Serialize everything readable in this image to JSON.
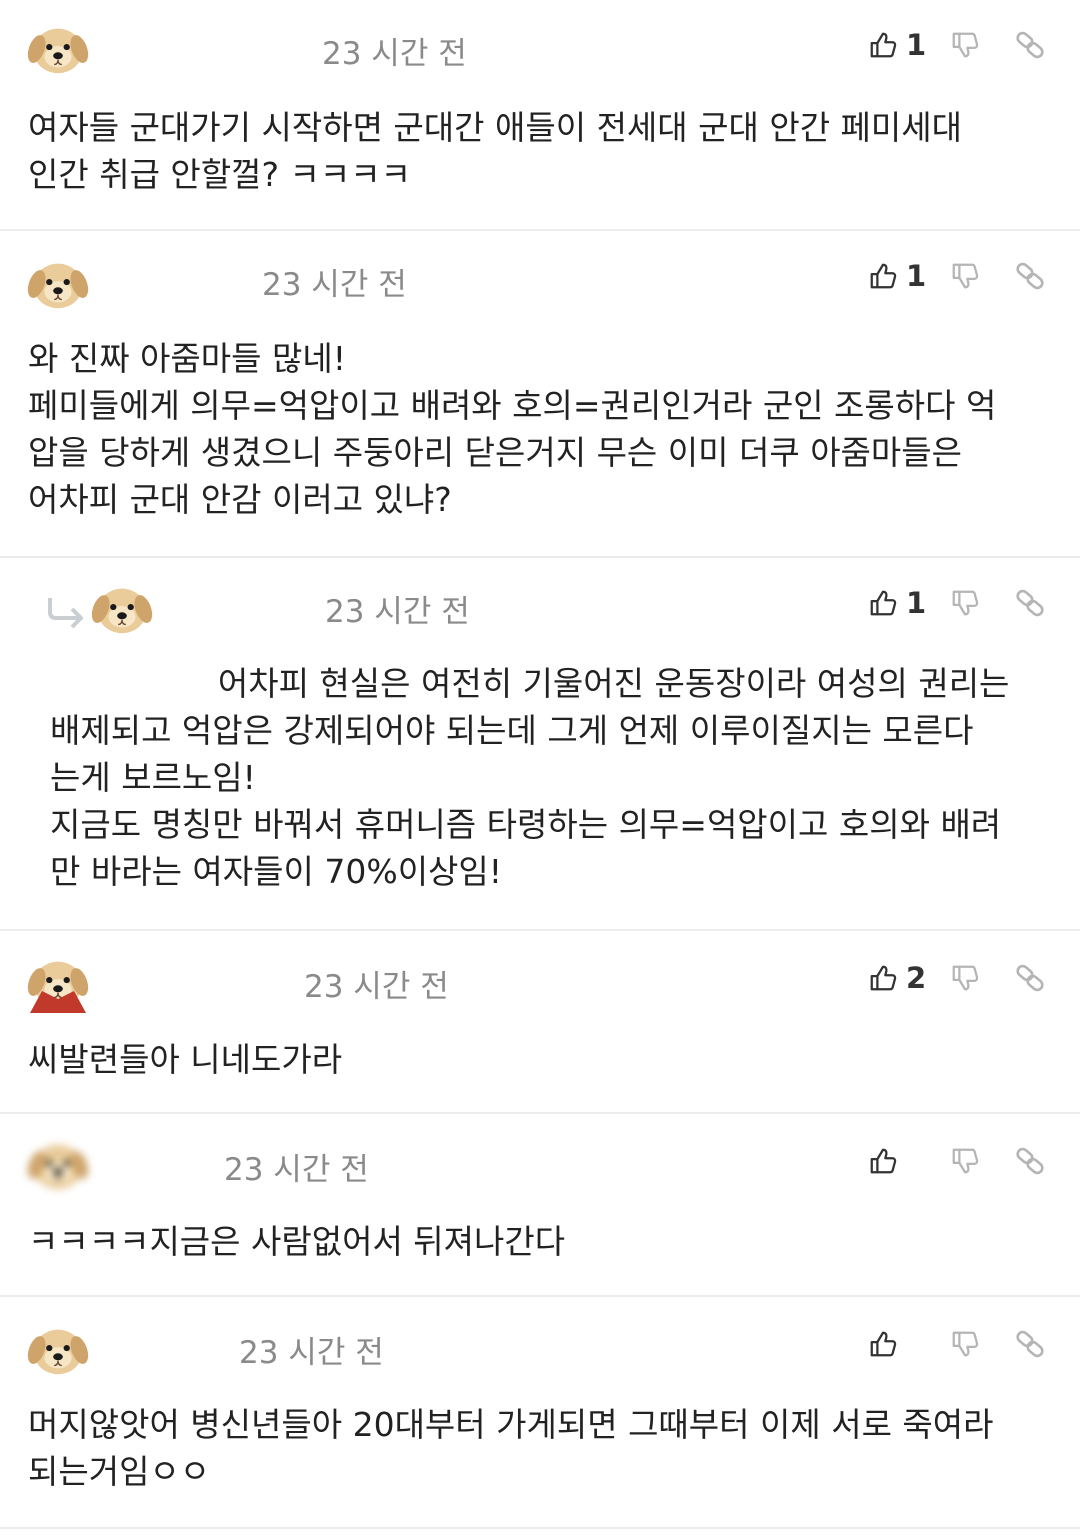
{
  "comments": [
    {
      "time": "23 시간 전",
      "likes": "1",
      "text": "여자들 군대가기 시작하면 군대간 애들이 전세대 군대 안간 페미세대\n인간 취급 안할껄? ㅋㅋㅋㅋ"
    },
    {
      "time": "23 시간 전",
      "likes": "1",
      "text": "와 진짜 아줌마들 많네!\n페미들에게 의무=억압이고 배려와 호의=권리인거라 군인 조롱하다 억\n압을 당하게 생겼으니 주둥아리 닫은거지 무슨 이미 더쿠 아줌마들은\n어차피 군대 안감 이러고 있냐?"
    },
    {
      "time": "23 시간 전",
      "likes": "1",
      "text": "                어차피 현실은 여전히 기울어진 운동장이라 여성의 권리는\n배제되고 억압은 강제되어야 되는데 그게 언제 이루이질지는 모른다\n는게 보르노임!\n지금도 명칭만 바꿔서 휴머니즘 타령하는 의무=억압이고 호의와 배려\n만 바라는 여자들이 70%이상임!"
    },
    {
      "time": "23 시간 전",
      "likes": "2",
      "text": "씨발련들아 니네도가라"
    },
    {
      "time": "23 시간 전",
      "likes": "",
      "text": "ㅋㅋㅋㅋ지금은 사람없어서 뒤져나간다"
    },
    {
      "time": "23 시간 전",
      "likes": "",
      "text": "머지않앗어 병신년들아 20대부터 가게되면 그때부터 이제 서로 죽여라\n되는거임ㅇㅇ"
    }
  ],
  "icons": {
    "like": "thumbs-up-icon",
    "dislike": "thumbs-down-icon",
    "link": "link-icon",
    "reply": "reply-arrow-icon",
    "avatar": "puppy-avatar"
  },
  "colors": {
    "text": "#222222",
    "meta": "#8a8a8a",
    "icon": "#333333",
    "icon_muted": "#b5b5b5",
    "divider": "#ececec"
  }
}
